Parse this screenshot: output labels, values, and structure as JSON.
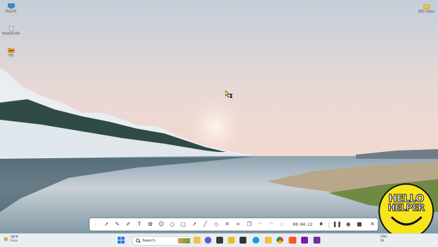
{
  "desktop": {
    "icons": [
      {
        "label": "This PC",
        "icon": "monitor-icon"
      },
      {
        "label": "Recycle Bin",
        "icon": "recycle-bin-icon"
      },
      {
        "label": "Git",
        "icon": "folder-icon"
      },
      {
        "label": "DSC Video",
        "icon": "folder-icon"
      }
    ]
  },
  "recording_toolbar": {
    "tools": [
      "drag-handle",
      "select-arrow",
      "pen",
      "highlighter",
      "text",
      "stamp",
      "smiley",
      "ellipse",
      "rectangle",
      "arrow",
      "line",
      "eraser",
      "blur",
      "undo",
      "redo",
      "clear"
    ],
    "timer": "00:04:22",
    "controls": [
      "pin",
      "pause",
      "webcam",
      "stop",
      "close"
    ]
  },
  "taskbar": {
    "weather": {
      "temp": "79°F",
      "condition": "Haze"
    },
    "search_label": "Search",
    "apps": [
      "start",
      "search",
      "file-explorer",
      "task-view",
      "chat",
      "office",
      "edge",
      "chrome",
      "file-manager",
      "brave",
      "vlc",
      "onenote",
      "obs"
    ],
    "tray": {
      "language": "ENG",
      "region": "IN"
    }
  },
  "badge": {
    "line1": "HELLO",
    "line2": "HELPER"
  },
  "colors": {
    "taskbar": "#e9eef3",
    "badge": "#f7e51c",
    "sky_top": "#c9d3dc",
    "sky_glow": "#f4dcd2"
  }
}
